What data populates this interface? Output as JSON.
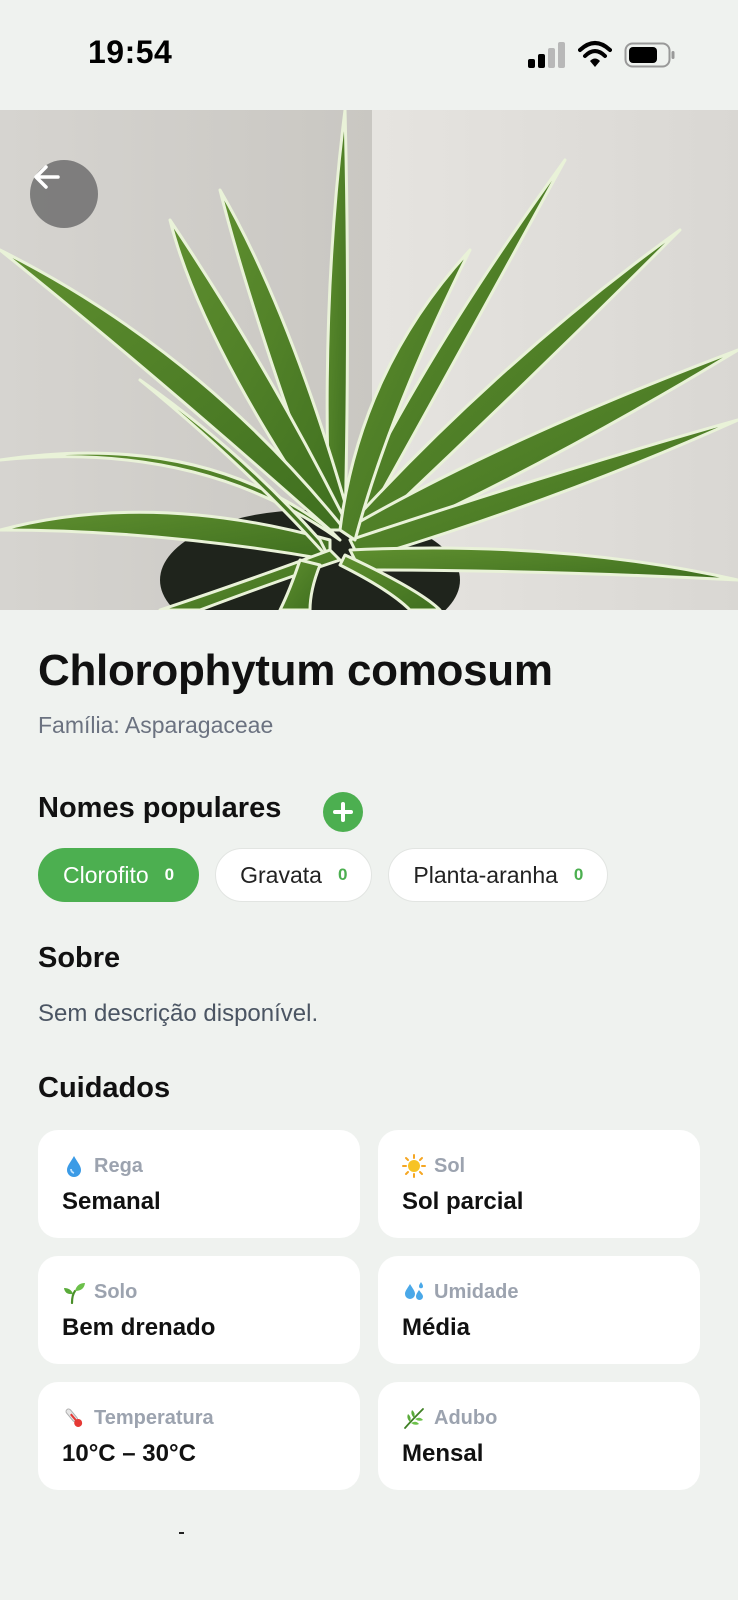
{
  "status_bar": {
    "time": "19:54"
  },
  "plant": {
    "scientific_name": "Chlorophytum comosum",
    "family": "Família: Asparagaceae"
  },
  "popular_names": {
    "heading": "Nomes populares",
    "items": [
      {
        "label": "Clorofito",
        "count": "0",
        "selected": true
      },
      {
        "label": "Gravata",
        "count": "0",
        "selected": false
      },
      {
        "label": "Planta-aranha",
        "count": "0",
        "selected": false
      }
    ]
  },
  "about": {
    "heading": "Sobre",
    "text": "Sem descrição disponível."
  },
  "care": {
    "heading": "Cuidados",
    "items": [
      {
        "label": "Rega",
        "value": "Semanal",
        "icon": "water-drop-icon"
      },
      {
        "label": "Sol",
        "value": "Sol parcial",
        "icon": "sun-icon"
      },
      {
        "label": "Solo",
        "value": "Bem drenado",
        "icon": "seedling-icon"
      },
      {
        "label": "Umidade",
        "value": "Média",
        "icon": "droplets-icon"
      },
      {
        "label": "Temperatura",
        "value": "10°C – 30°C",
        "icon": "thermometer-icon"
      },
      {
        "label": "Adubo",
        "value": "Mensal",
        "icon": "herb-icon"
      }
    ]
  },
  "colors": {
    "accent": "#4caf50",
    "background": "#eff2ef",
    "card": "#ffffff",
    "muted_text": "#6b7280"
  }
}
